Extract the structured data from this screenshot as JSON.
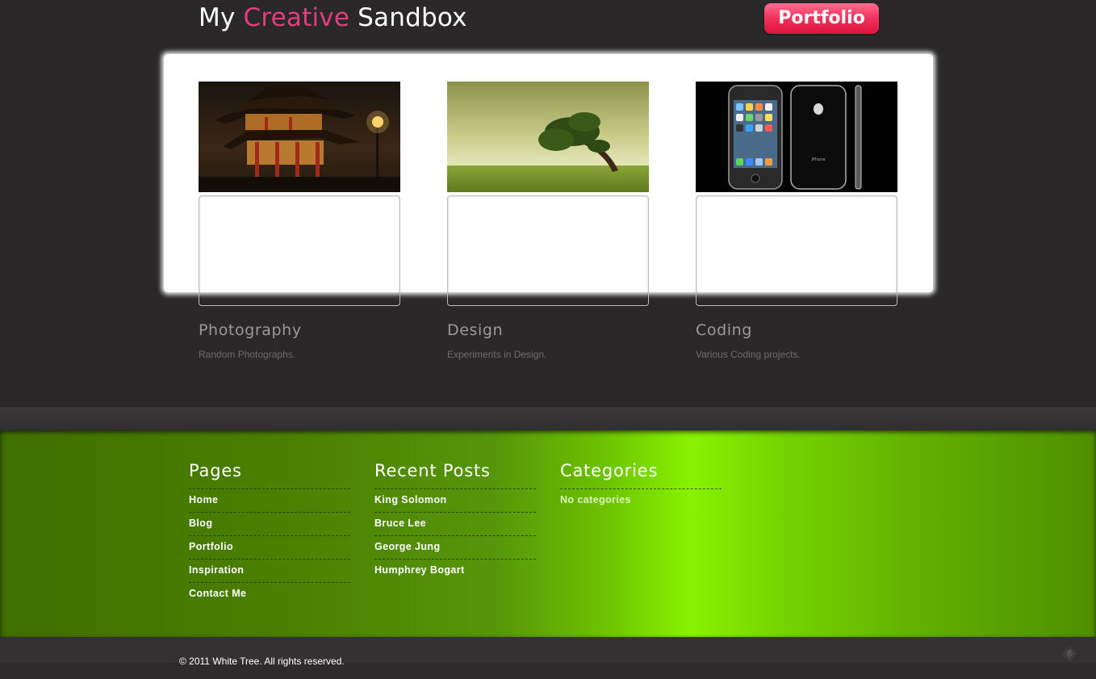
{
  "header": {
    "title_pre": "My ",
    "title_accent": "Creative",
    "title_post": " Sandbox",
    "nav_button": "Portfolio"
  },
  "portfolio": {
    "cards": [
      {
        "title": "Photography",
        "description": "Random Photographs.",
        "thumbnail": "pagoda-at-night"
      },
      {
        "title": "Design",
        "description": "Experiments in Design.",
        "thumbnail": "lone-tree-on-field"
      },
      {
        "title": "Coding",
        "description": "Various Coding projects.",
        "thumbnail": "iphone-front-back"
      }
    ]
  },
  "footer": {
    "pages": {
      "heading": "Pages",
      "items": [
        "Home",
        "Blog",
        "Portfolio",
        "Inspiration",
        "Contact Me"
      ]
    },
    "recent_posts": {
      "heading": "Recent Posts",
      "items": [
        "King Solomon",
        "Bruce Lee",
        "George Jung",
        "Humphrey Bogart"
      ]
    },
    "categories": {
      "heading": "Categories",
      "items": [
        "No categories"
      ]
    },
    "copyright": "© 2011 White Tree. All rights reserved.",
    "corner_icon": "leaf-logo-icon"
  },
  "colors": {
    "background": "#2a2829",
    "accent_pink": "#e23e7d",
    "button_red": "#f4355f",
    "footer_green": "#88f200"
  }
}
